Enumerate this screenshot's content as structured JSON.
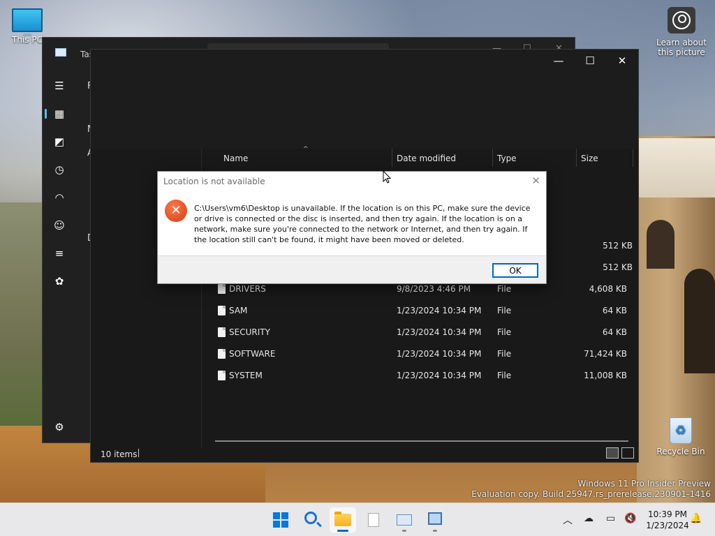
{
  "desktop": {
    "icons": {
      "this_pc": "This PC",
      "learn": "Learn about this picture",
      "recycle_bin": "Recycle Bin"
    },
    "watermark": {
      "line1": "Windows 11 Pro Insider Preview",
      "line2": "Evaluation copy. Build 25947.rs_prerelease.230901-1416"
    }
  },
  "task_manager": {
    "title": "Tas",
    "fragments": [
      "F",
      "N",
      "A",
      "D"
    ],
    "nav_icons": [
      "hamburger-icon",
      "processes-icon",
      "performance-icon",
      "app-history-icon",
      "startup-icon",
      "users-icon",
      "details-icon",
      "services-icon",
      "settings-icon"
    ]
  },
  "explorer": {
    "columns": {
      "name": "Name",
      "date": "Date modified",
      "type": "Type",
      "size": "Size"
    },
    "rows": [
      {
        "name": "",
        "date": "",
        "type": "",
        "size": "512 KB"
      },
      {
        "name": "",
        "date": "",
        "type": "",
        "size": "512 KB"
      },
      {
        "name": "DRIVERS",
        "date": "9/8/2023 4:46 PM",
        "type": "File",
        "size": "4,608 KB"
      },
      {
        "name": "SAM",
        "date": "1/23/2024 10:34 PM",
        "type": "File",
        "size": "64 KB"
      },
      {
        "name": "SECURITY",
        "date": "1/23/2024 10:34 PM",
        "type": "File",
        "size": "64 KB"
      },
      {
        "name": "SOFTWARE",
        "date": "1/23/2024 10:34 PM",
        "type": "File",
        "size": "71,424 KB"
      },
      {
        "name": "SYSTEM",
        "date": "1/23/2024 10:34 PM",
        "type": "File",
        "size": "11,008 KB"
      }
    ],
    "status": {
      "items": "10 items"
    }
  },
  "dialog": {
    "title": "Location is not available",
    "message": "C:\\Users\\vm6\\Desktop is unavailable. If the location is on this PC, make sure the device or drive is connected or the disc is inserted, and then try again. If the location is on a network, make sure you're connected to the network or Internet, and then try again. If the location still can't be found, it might have been moved or deleted.",
    "ok_label": "OK"
  },
  "taskbar": {
    "time": "10:39 PM",
    "date": "1/23/2024"
  },
  "colors": {
    "accent": "#0067c0",
    "error": "#d33a10"
  }
}
